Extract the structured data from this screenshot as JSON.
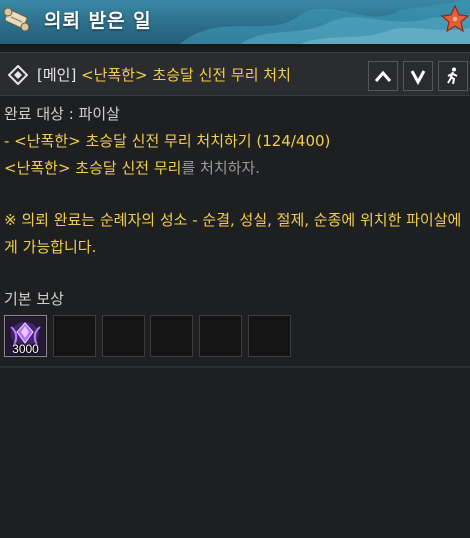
{
  "header": {
    "title": "의뢰 받은 일",
    "scroll_icon": "scroll-icon",
    "favorite_icon": "starfish-icon"
  },
  "quest": {
    "tag": "[메인]",
    "title": "<난폭한> 초승달 신전 무리 처치",
    "buttons": [
      "chevron-up-icon",
      "chevron-down-icon",
      "running-person-icon"
    ]
  },
  "details": {
    "target": "완료 대상 : 파이살",
    "objective_1": "- <난폭한> 초승달 신전 무리 처치하기 (124/400)",
    "objective_2_highlight": "<난폭한> 초승달 신전 무리",
    "objective_2_rest": "를 처치하자.",
    "note": "※ 의뢰 완료는 순례자의 성소 - 순결, 성실, 절제, 순종에 위치한 파이살에게 가능합니다."
  },
  "rewards": {
    "label": "기본 보상",
    "items": [
      {
        "icon": "purple-gem-icon",
        "count": "3000"
      }
    ],
    "empty_slots": 5
  },
  "colors": {
    "header_blue": "#2c6f8c",
    "quest_yellow": "#f2cf4a",
    "background": "#1e1f21"
  }
}
